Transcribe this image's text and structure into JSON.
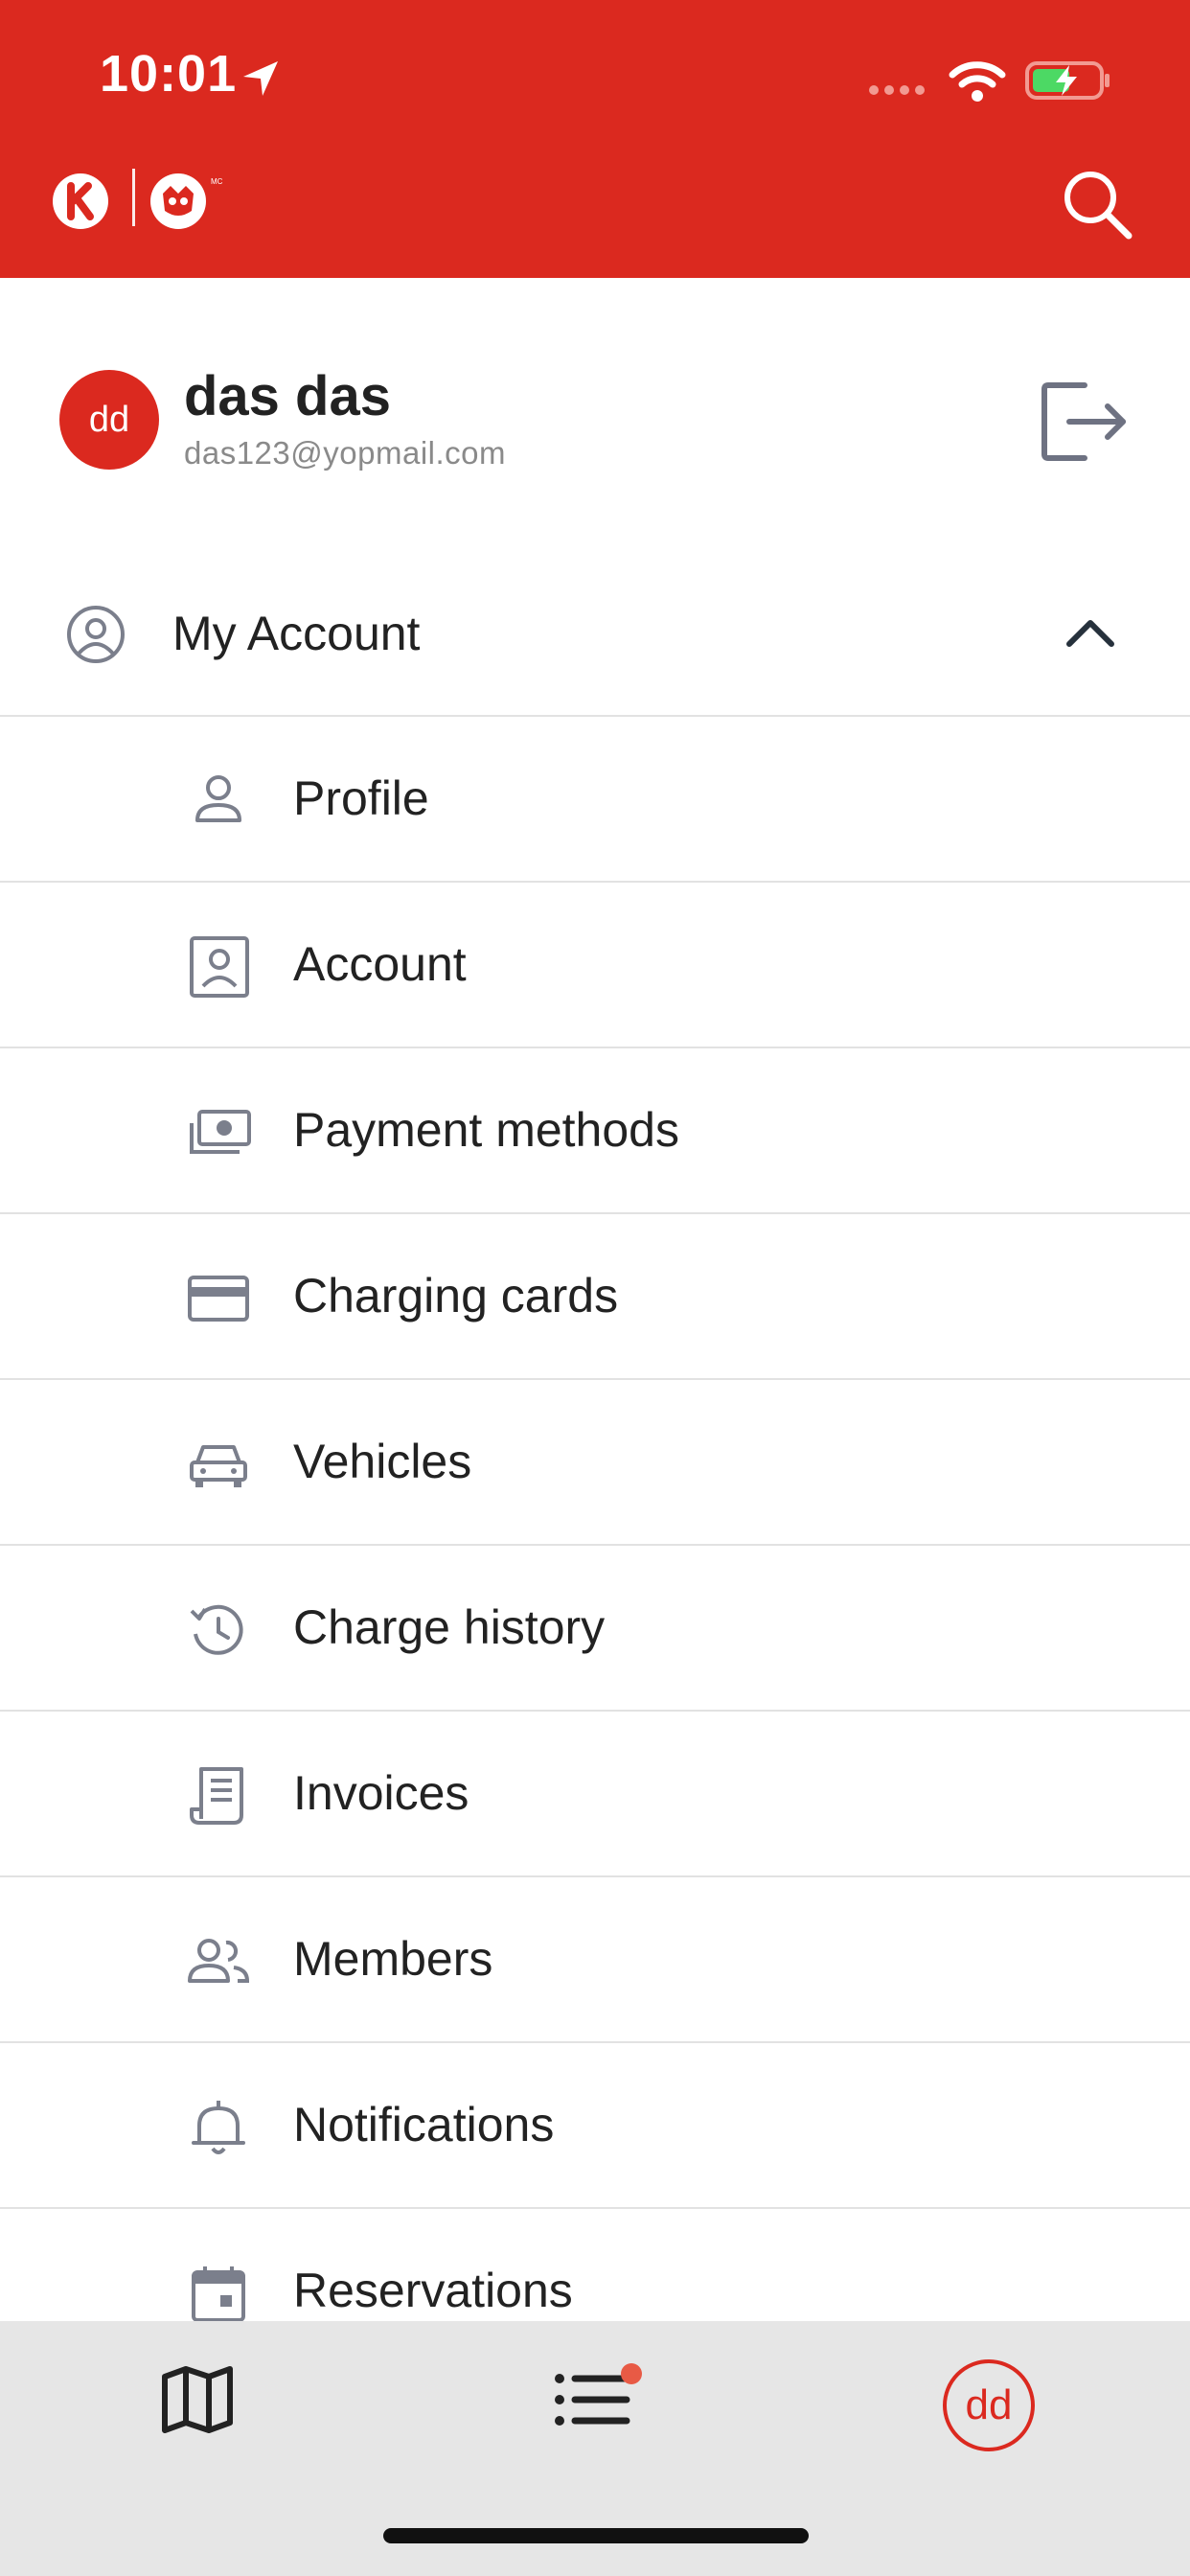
{
  "status_bar": {
    "time": "10:01"
  },
  "profile": {
    "initials": "dd",
    "name": "das das",
    "email": "das123@yopmail.com"
  },
  "section": {
    "label": "My Account"
  },
  "menu": {
    "items": [
      {
        "label": "Profile",
        "icon": "person-icon"
      },
      {
        "label": "Account",
        "icon": "account-portrait-icon"
      },
      {
        "label": "Payment methods",
        "icon": "cash-icon"
      },
      {
        "label": "Charging cards",
        "icon": "card-icon"
      },
      {
        "label": "Vehicles",
        "icon": "car-icon"
      },
      {
        "label": "Charge history",
        "icon": "history-icon"
      },
      {
        "label": "Invoices",
        "icon": "receipt-icon"
      },
      {
        "label": "Members",
        "icon": "group-icon"
      },
      {
        "label": "Notifications",
        "icon": "bell-icon"
      },
      {
        "label": "Reservations",
        "icon": "calendar-icon"
      }
    ]
  },
  "tab_bar": {
    "profile_initials": "dd"
  },
  "colors": {
    "brand_red": "#db291f",
    "icon_gray": "#7b7f8c",
    "tab_background": "#e6e6e6"
  }
}
